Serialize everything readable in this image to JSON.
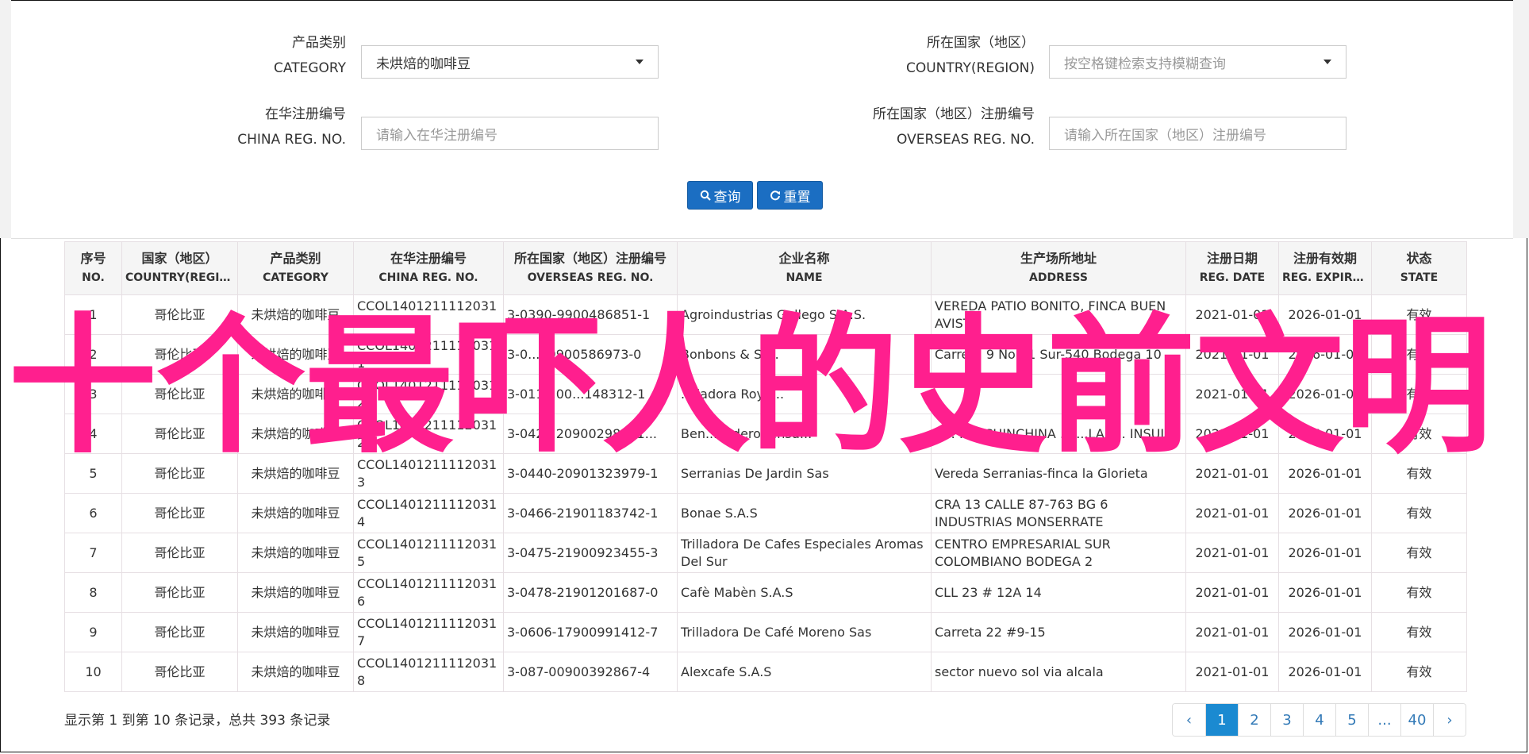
{
  "form": {
    "category": {
      "label_cn": "产品类别",
      "label_en": "CATEGORY",
      "value": "未烘焙的咖啡豆"
    },
    "country": {
      "label_cn": "所在国家（地区）",
      "label_en": "COUNTRY(REGION)",
      "placeholder": "按空格键检索支持模糊查询"
    },
    "china_reg": {
      "label_cn": "在华注册编号",
      "label_en": "CHINA REG. NO.",
      "placeholder": "请输入在华注册编号"
    },
    "overseas_reg": {
      "label_cn": "所在国家（地区）注册编号",
      "label_en": "OVERSEAS REG. NO.",
      "placeholder": "请输入所在国家（地区）注册编号"
    },
    "search_btn": "查询",
    "reset_btn": "重置"
  },
  "table": {
    "headers": [
      {
        "cn": "序号",
        "en": "NO."
      },
      {
        "cn": "国家（地区）",
        "en": "COUNTRY(REGIO..."
      },
      {
        "cn": "产品类别",
        "en": "CATEGORY"
      },
      {
        "cn": "在华注册编号",
        "en": "CHINA REG. NO."
      },
      {
        "cn": "所在国家（地区）注册编号",
        "en": "OVERSEAS REG. NO."
      },
      {
        "cn": "企业名称",
        "en": "NAME"
      },
      {
        "cn": "生产场所地址",
        "en": "ADDRESS"
      },
      {
        "cn": "注册日期",
        "en": "REG. DATE"
      },
      {
        "cn": "注册有效期",
        "en": "REG. EXPIRE ..."
      },
      {
        "cn": "状态",
        "en": "STATE"
      }
    ],
    "rows": [
      [
        "1",
        "哥伦比亚",
        "未烘焙的咖啡豆",
        "CCOL14012111120310",
        "3-0390-9900486851-1",
        "Agroindustrias Gallego S.A.S.",
        "VEREDA PATIO BONITO, FINCA BUEN AVISTA",
        "2021-01-01",
        "2026-01-01",
        "有效"
      ],
      [
        "2",
        "哥伦比亚",
        "未烘焙的咖啡豆",
        "CCOL14012111120311",
        "3-0...19900586973-0",
        "Bonbons & St...",
        "Carrera 9 No 61 Sur-540 Bodega 10",
        "2021-01-01",
        "2026-01-01",
        "有效"
      ],
      [
        "3",
        "哥伦比亚",
        "未烘焙的咖啡豆",
        "CCOL14012111120312",
        "3-011...00...148312-1",
        "...iladora Roya...",
        "",
        "2021-01-01",
        "2026-01-01",
        "有效"
      ],
      [
        "4",
        "哥伦比亚",
        "未烘焙的咖啡豆",
        "CCOL14012111120312",
        "3-042...20900298861...",
        "Ben...ijadero ...nsu...",
        "K... ...A CHINCHINA ... ...LA F... INSULA",
        "2021-01-01",
        "2026-01-01",
        "有效"
      ],
      [
        "5",
        "哥伦比亚",
        "未烘焙的咖啡豆",
        "CCOL14012111120313",
        "3-0440-20901323979-1",
        "Serranias De Jardin Sas",
        "Vereda Serranias-finca la Glorieta",
        "2021-01-01",
        "2026-01-01",
        "有效"
      ],
      [
        "6",
        "哥伦比亚",
        "未烘焙的咖啡豆",
        "CCOL14012111120314",
        "3-0466-21901183742-1",
        "Bonae S.A.S",
        "CRA 13 CALLE 87-763 BG 6 INDUSTRIAS MONSERRATE",
        "2021-01-01",
        "2026-01-01",
        "有效"
      ],
      [
        "7",
        "哥伦比亚",
        "未烘焙的咖啡豆",
        "CCOL14012111120315",
        "3-0475-21900923455-3",
        "Trilladora De Cafes Especiales Aromas Del Sur",
        "CENTRO EMPRESARIAL SUR COLOMBIANO BODEGA 2",
        "2021-01-01",
        "2026-01-01",
        "有效"
      ],
      [
        "8",
        "哥伦比亚",
        "未烘焙的咖啡豆",
        "CCOL14012111120316",
        "3-0478-21901201687-0",
        "Cafè Mabèn S.A.S",
        "CLL 23 # 12A 14",
        "2021-01-01",
        "2026-01-01",
        "有效"
      ],
      [
        "9",
        "哥伦比亚",
        "未烘焙的咖啡豆",
        "CCOL14012111120317",
        "3-0606-17900991412-7",
        "Trilladora De Café Moreno Sas",
        "Carreta 22 #9-15",
        "2021-01-01",
        "2026-01-01",
        "有效"
      ],
      [
        "10",
        "哥伦比亚",
        "未烘焙的咖啡豆",
        "CCOL14012111120318",
        "3-087-00900392867-4",
        "Alexcafe S.A.S",
        "sector nuevo sol via alcala",
        "2021-01-01",
        "2026-01-01",
        "有效"
      ]
    ]
  },
  "footer": {
    "summary": "显示第 1 到第 10 条记录，总共 393 条记录",
    "pages": [
      "‹",
      "1",
      "2",
      "3",
      "4",
      "5",
      "...",
      "40",
      "›"
    ],
    "active_page": "1"
  },
  "overlay_text": "十个最吓人的史前文明",
  "colors": {
    "primary": "#1b6ec2",
    "overlay": "#ff1f8e",
    "page_active": "#1b8ad1"
  }
}
